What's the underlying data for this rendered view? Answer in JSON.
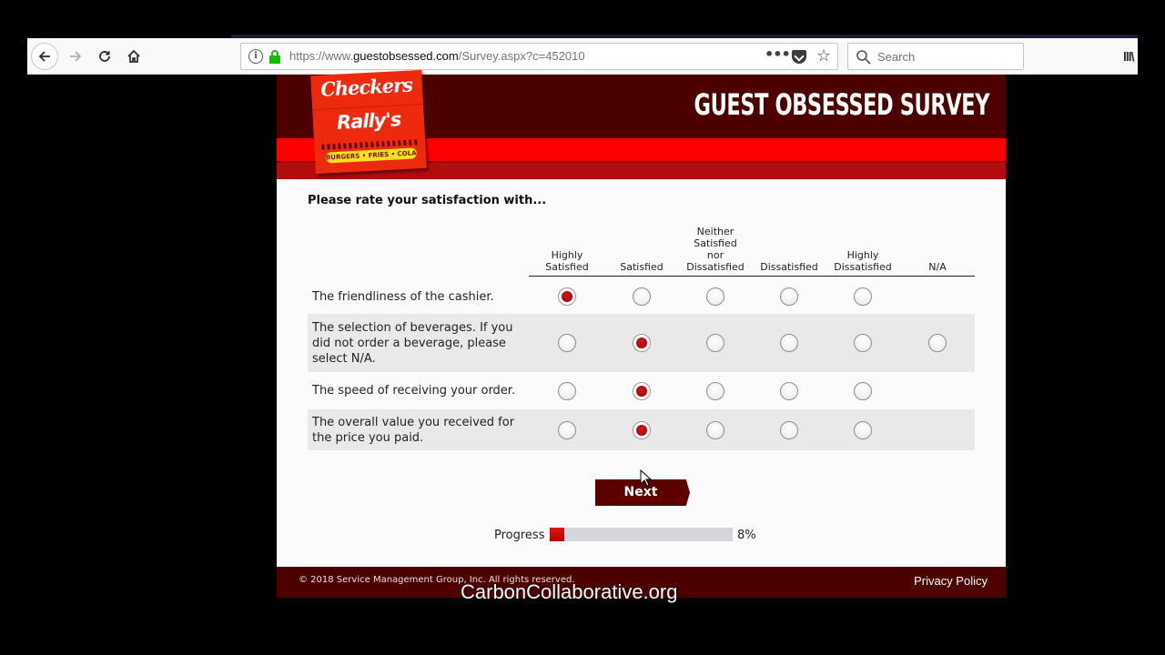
{
  "browser": {
    "url_prefix": "https://www.",
    "url_host": "guestobsessed.com",
    "url_path": "/Survey.aspx?c=452010",
    "url_more": "•••",
    "search_placeholder": "Search",
    "icons": [
      "back-arrow-icon",
      "forward-arrow-icon",
      "reload-icon",
      "home-icon",
      "info-icon",
      "lock-icon",
      "more-icon",
      "pocket-icon",
      "star-icon",
      "search-icon",
      "library-icon"
    ]
  },
  "header": {
    "logo_line1": "Checkers",
    "logo_line2": "Rally's",
    "logo_tagline": "BURGERS • FRIES • COLAS",
    "title": "GUEST OBSESSED SURVEY",
    "colors": {
      "dark": "#4d0000",
      "red": "#ff0000",
      "band": "#b30c0c"
    }
  },
  "survey": {
    "prompt": "Please rate your satisfaction with...",
    "columns": [
      [
        "Highly",
        "Satisfied"
      ],
      [
        "Satisfied"
      ],
      [
        "Neither",
        "Satisfied",
        "nor",
        "Dissatisfied"
      ],
      [
        "Dissatisfied"
      ],
      [
        "Highly",
        "Dissatisfied"
      ],
      [
        "N/A"
      ]
    ],
    "column_labels": [
      "Highly Satisfied",
      "Satisfied",
      "Neither Satisfied nor Dissatisfied",
      "Dissatisfied",
      "Highly Dissatisfied",
      "N/A"
    ],
    "rows": [
      {
        "lines": [
          "The friendliness of the cashier."
        ],
        "selected": 0,
        "has_na": false
      },
      {
        "lines": [
          "The selection of beverages. If you",
          "did not order a beverage, please",
          "select N/A."
        ],
        "selected": 1,
        "has_na": true
      },
      {
        "lines": [
          "The speed of receiving your order."
        ],
        "selected": 1,
        "has_na": false
      },
      {
        "lines": [
          "The overall value you received for",
          "the price you paid."
        ],
        "selected": 1,
        "has_na": false
      }
    ],
    "next_label": "Next",
    "progress_label": "Progress",
    "progress_percent": 8,
    "progress_text": "8%"
  },
  "footer": {
    "copyright": "© 2018 Service Management Group, Inc. All rights reserved.",
    "privacy": "Privacy Policy"
  },
  "watermark": "CarbonCollaborative.org"
}
